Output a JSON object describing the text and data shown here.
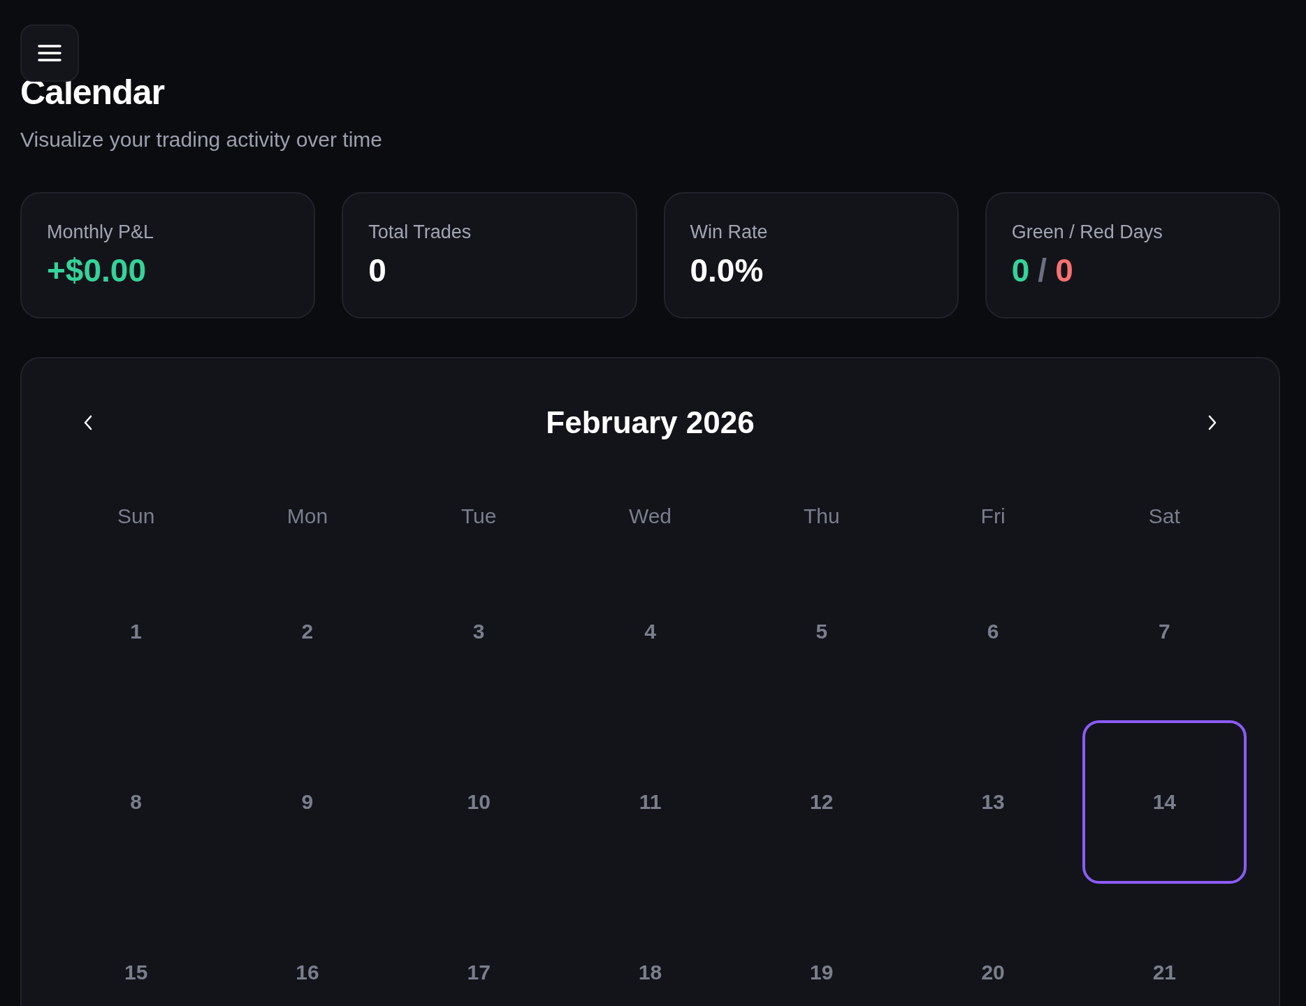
{
  "page": {
    "title": "Calendar",
    "subtitle": "Visualize your trading activity over time"
  },
  "stats": [
    {
      "kind": "positive",
      "label": "Monthly P&L",
      "value": "+$0.00"
    },
    {
      "kind": "plain",
      "label": "Total Trades",
      "value": "0"
    },
    {
      "kind": "plain",
      "label": "Win Rate",
      "value": "0.0%"
    },
    {
      "kind": "split",
      "label": "Green / Red Days",
      "green": "0",
      "separator": "/",
      "red": "0"
    }
  ],
  "calendar": {
    "month": "February 2026",
    "weekdays": [
      "Sun",
      "Mon",
      "Tue",
      "Wed",
      "Thu",
      "Fri",
      "Sat"
    ],
    "days": [
      {
        "label": "1",
        "selected": false
      },
      {
        "label": "2",
        "selected": false
      },
      {
        "label": "3",
        "selected": false
      },
      {
        "label": "4",
        "selected": false
      },
      {
        "label": "5",
        "selected": false
      },
      {
        "label": "6",
        "selected": false
      },
      {
        "label": "7",
        "selected": false
      },
      {
        "label": "8",
        "selected": false
      },
      {
        "label": "9",
        "selected": false
      },
      {
        "label": "10",
        "selected": false
      },
      {
        "label": "11",
        "selected": false
      },
      {
        "label": "12",
        "selected": false
      },
      {
        "label": "13",
        "selected": false
      },
      {
        "label": "14",
        "selected": true
      },
      {
        "label": "15",
        "selected": false
      },
      {
        "label": "16",
        "selected": false
      },
      {
        "label": "17",
        "selected": false
      },
      {
        "label": "18",
        "selected": false
      },
      {
        "label": "19",
        "selected": false
      },
      {
        "label": "20",
        "selected": false
      },
      {
        "label": "21",
        "selected": false
      }
    ]
  }
}
